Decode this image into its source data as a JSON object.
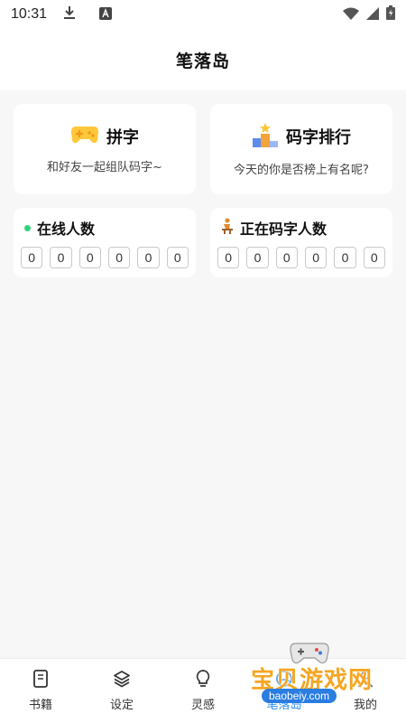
{
  "status": {
    "time": "10:31"
  },
  "header": {
    "title": "笔落岛"
  },
  "cards": [
    {
      "title": "拼字",
      "subtitle": "和好友一起组队码字~",
      "icon": "gamepad-icon"
    },
    {
      "title": "码字排行",
      "subtitle": "今天的你是否榜上有名呢?",
      "icon": "podium-icon"
    }
  ],
  "counters": [
    {
      "title": "在线人数",
      "icon": "green-dot",
      "digits": [
        "0",
        "0",
        "0",
        "0",
        "0",
        "0"
      ]
    },
    {
      "title": "正在码字人数",
      "icon": "typing-person-icon",
      "digits": [
        "0",
        "0",
        "0",
        "0",
        "0",
        "0"
      ]
    }
  ],
  "tabs": [
    {
      "label": "书籍",
      "icon": "book-icon"
    },
    {
      "label": "设定",
      "icon": "layers-icon"
    },
    {
      "label": "灵感",
      "icon": "lightbulb-icon"
    },
    {
      "label": "笔落岛",
      "icon": "island-icon"
    },
    {
      "label": "我的",
      "icon": "user-icon"
    }
  ],
  "watermark": {
    "text": "宝贝游戏网",
    "url": "baobeiy.com"
  },
  "colors": {
    "accent": "#2a8cf0",
    "online": "#2fd27b",
    "watermark": "#f5a623"
  }
}
